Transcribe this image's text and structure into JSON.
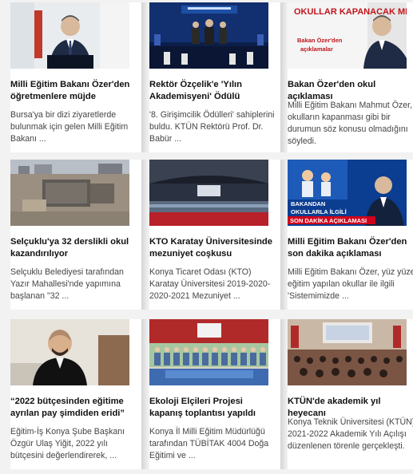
{
  "news": [
    {
      "title": "Milli Eğitim Bakanı Özer'den öğretmenlere müjde",
      "summary": "Bursa'ya bir dizi ziyaretlerde bulunmak için gelen Milli Eğitim Bakanı ...",
      "image": "minister-podium-photo"
    },
    {
      "title": "Rektör Özçelik'e 'Yılın Akademisyeni' Ödülü",
      "summary": "'8. Girişimcilik Ödülleri' sahiplerini buldu. KTÜN Rektörü Prof. Dr. Babür ...",
      "image": "award-ceremony-stage-photo"
    },
    {
      "title": "Bakan Özer'den okul açıklaması",
      "summary": "Milli Eğitim Bakanı Mahmut Özer, okulların kapanması gibi bir durumun söz konusu olmadığını söyledi.",
      "image": "okullar-kapanacak-mi-graphic",
      "image_text": {
        "headline": "OKULLAR KAPANACAK MI?",
        "sub1": "Bakan Özer'den",
        "sub2": "açıklamalar"
      }
    },
    {
      "title": "Selçuklu'ya 32 derslikli okul kazandırılıyor",
      "summary": "Selçuklu Belediyesi tarafından Yazır Mahallesi'nde yapımına başlanan \"32 ...",
      "image": "school-construction-aerial-photo"
    },
    {
      "title": "KTO Karatay Üniversitesinde mezuniyet coşkusu",
      "summary": "Konya Ticaret Odası (KTO) Karatay Üniversitesi 2019-2020-2020-2021 Mezuniyet ...",
      "image": "graduation-stadium-photo"
    },
    {
      "title": "Milli Eğitim Bakanı Özer'den son dakika açıklaması",
      "summary": "Milli Eğitim Bakanı Özer, yüz yüze eğitim yapılan okullar ile ilgili 'Sistemimizde ...",
      "image": "son-dakika-graphic",
      "image_text": {
        "line1": "BAKANDAN",
        "line2": "OKULLARLA İLGİLİ",
        "line3": "SON DAKİKA AÇIKLAMASI"
      }
    },
    {
      "title": "“2022 bütçesinden eğitime ayrılan pay şimdiden eridi”",
      "summary": "Eğitim-İş Konya Şube Başkanı Özgür Ulaş Yiğit, 2022 yılı bütçesini değerlendirerek, ...",
      "image": "union-president-portrait-photo"
    },
    {
      "title": "Ekoloji Elçileri Projesi kapanış toplantısı yapıldı",
      "summary": "Konya İl Milli Eğitim Müdürlüğü tarafından TÜBİTAK 4004 Doğa Eğitimi ve ...",
      "image": "ecology-project-group-photo"
    },
    {
      "title": "KTÜN'de akademik yıl heyecanı",
      "summary": "Konya Teknik Üniversitesi (KTÜN) 2021-2022 Akademik Yılı Açılışı düzenlenen törenle gerçekleşti.",
      "image": "academic-year-auditorium-photo"
    }
  ]
}
